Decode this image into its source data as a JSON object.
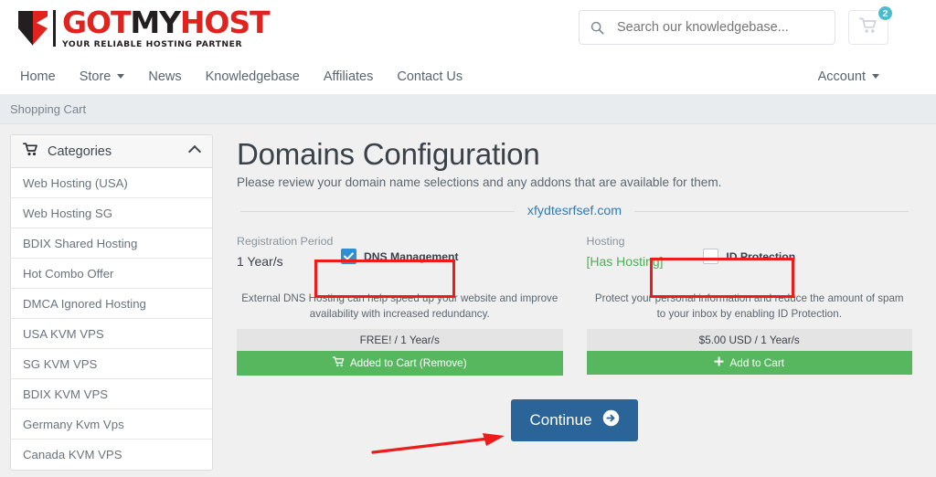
{
  "brand": {
    "name_parts": [
      {
        "text": "GOT",
        "color": "#e0231f"
      },
      {
        "text": "MY",
        "color": "#231f20"
      },
      {
        "text": "HOST",
        "color": "#e0231f"
      }
    ],
    "tagline": "YOUR RELIABLE HOSTING PARTNER",
    "red": "#e0231f",
    "black": "#231f20"
  },
  "search": {
    "placeholder": "Search our knowledgebase...",
    "value": "",
    "icon": "search-icon"
  },
  "cart": {
    "icon": "shopping-cart-icon",
    "badge_count": "2",
    "badge_color": "#4bbcd0"
  },
  "nav": {
    "items": [
      {
        "label": "Home",
        "has_caret": false
      },
      {
        "label": "Store",
        "has_caret": true
      },
      {
        "label": "News",
        "has_caret": false
      },
      {
        "label": "Knowledgebase",
        "has_caret": false
      },
      {
        "label": "Affiliates",
        "has_caret": false
      },
      {
        "label": "Contact Us",
        "has_caret": false
      }
    ],
    "account": {
      "label": "Account",
      "has_caret": true
    }
  },
  "breadcrumb": {
    "text": "Shopping Cart"
  },
  "sidebar": {
    "header": {
      "label": "Categories",
      "icon": "cart-icon",
      "collapse_icon": "chevron-up-icon"
    },
    "items": [
      {
        "label": "Web Hosting (USA)"
      },
      {
        "label": "Web Hosting SG"
      },
      {
        "label": "BDIX Shared Hosting"
      },
      {
        "label": "Hot Combo Offer"
      },
      {
        "label": "DMCA Ignored Hosting"
      },
      {
        "label": "USA KVM VPS"
      },
      {
        "label": "SG KVM VPS"
      },
      {
        "label": "BDIX KVM VPS"
      },
      {
        "label": "Germany Kvm Vps"
      },
      {
        "label": "Canada KVM VPS"
      }
    ]
  },
  "main": {
    "title": "Domains Configuration",
    "subtitle": "Please review your domain name selections and any addons that are available for them.",
    "domain_name": "xfydtesrfsef.com",
    "domain_name_color": "#2e7bb5",
    "registration": {
      "label": "Registration Period",
      "value": "1 Year/s"
    },
    "hosting": {
      "label": "Hosting",
      "value": "[Has Hosting]",
      "value_color": "#4caf50"
    },
    "addons": [
      {
        "name": "DNS Management",
        "checked": true,
        "description": "External DNS Hosting can help speed up your website and improve availability with increased redundancy.",
        "price": "FREE! / 1 Year/s",
        "button_label": "Added to Cart (Remove)",
        "button_icon": "cart-icon",
        "button_color": "#57b75e"
      },
      {
        "name": "ID Protection",
        "checked": false,
        "description": "Protect your personal information and reduce the amount of spam to your inbox by enabling ID Protection.",
        "price": "$5.00 USD / 1 Year/s",
        "button_label": "Add to Cart",
        "button_icon": "plus-icon",
        "button_color": "#57b75e"
      }
    ],
    "continue": {
      "label": "Continue",
      "icon": "arrow-circle-right-icon",
      "color": "#2b6498"
    }
  },
  "annotations": {
    "highlight_color": "#ee1b1b",
    "boxes": [
      "dns-management-checkbox",
      "id-protection-checkbox"
    ],
    "arrow_target": "continue-button"
  }
}
